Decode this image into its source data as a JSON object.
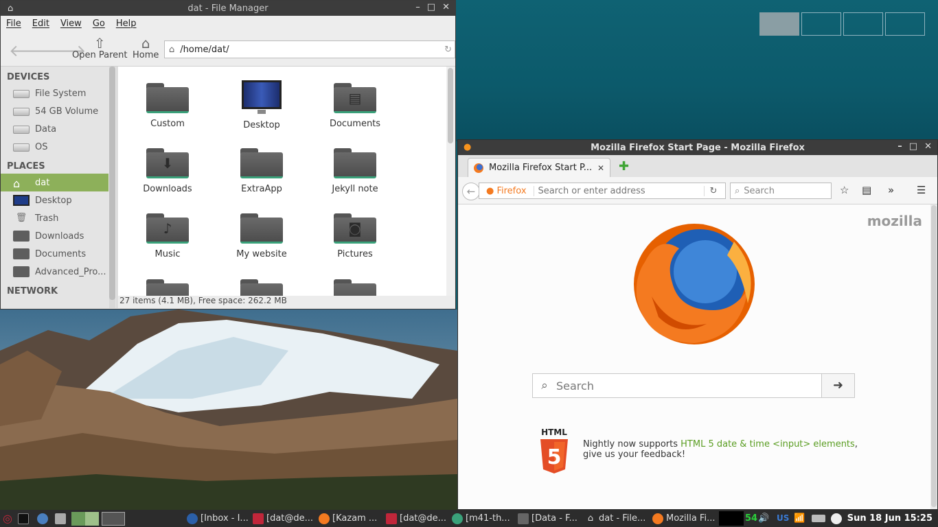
{
  "desktop": {
    "workspaces": [
      "",
      "",
      "",
      ""
    ]
  },
  "file_manager": {
    "title": "dat - File Manager",
    "menu": [
      "File",
      "Edit",
      "View",
      "Go",
      "Help"
    ],
    "toolbar": {
      "open_parent": "Open Parent",
      "home": "Home"
    },
    "path": "/home/dat/",
    "sidebar": {
      "devices_header": "DEVICES",
      "devices": [
        "File System",
        "54 GB Volume",
        "Data",
        "OS"
      ],
      "places_header": "PLACES",
      "places": [
        "dat",
        "Desktop",
        "Trash",
        "Downloads",
        "Documents",
        "Advanced_Pro..."
      ],
      "network_header": "NETWORK"
    },
    "files": [
      "Custom",
      "Desktop",
      "Documents",
      "Downloads",
      "ExtraApp",
      "Jekyll note",
      "Music",
      "My website",
      "Pictures"
    ],
    "status": "27 items (4.1 MB), Free space: 262.2 MB"
  },
  "firefox": {
    "title": "Mozilla Firefox Start Page - Mozilla Firefox",
    "tab_label": "Mozilla Firefox Start P...",
    "identity_badge": "Firefox",
    "url_placeholder": "Search or enter address",
    "search_placeholder": "Search",
    "brand": "mozilla",
    "page_search_placeholder": "Search",
    "html5_label": "HTML",
    "snippet_prefix": "Nightly now supports ",
    "snippet_link": "HTML 5 date & time <input> elements",
    "snippet_suffix": ",",
    "snippet_line2": "give us your feedback!"
  },
  "taskbar": {
    "tasks": [
      "[Inbox - I...",
      "[dat@de...",
      "[Kazam ...",
      "[dat@de...",
      "[m41-th...",
      "[Data - F...",
      "dat - File...",
      "Mozilla Fi..."
    ],
    "cpu_value": "54",
    "keyboard": "US",
    "clock": "Sun 18 Jun 15:25"
  },
  "colors": {
    "accent": "#8db05a",
    "title_bar": "#3c3c3c",
    "link": "#5a9d22",
    "folder_stripe": "#3aa17a"
  }
}
